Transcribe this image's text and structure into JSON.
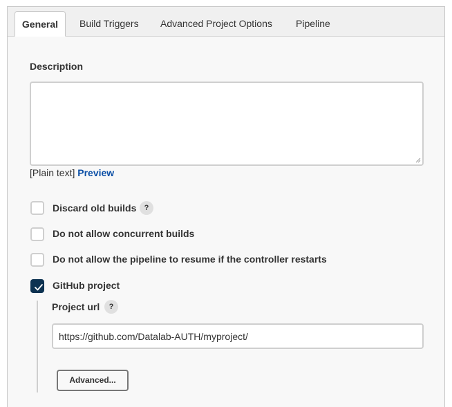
{
  "tabs": [
    {
      "label": "General",
      "active": true
    },
    {
      "label": "Build Triggers",
      "active": false
    },
    {
      "label": "Advanced Project Options",
      "active": false
    },
    {
      "label": "Pipeline",
      "active": false
    }
  ],
  "description": {
    "label": "Description",
    "value": "",
    "format_prefix": "[Plain text]",
    "preview_link": "Preview"
  },
  "options": [
    {
      "label": "Discard old builds",
      "checked": false,
      "has_help": true
    },
    {
      "label": "Do not allow concurrent builds",
      "checked": false,
      "has_help": false
    },
    {
      "label": "Do not allow the pipeline to resume if the controller restarts",
      "checked": false,
      "has_help": false
    },
    {
      "label": "GitHub project",
      "checked": true,
      "has_help": false
    }
  ],
  "github": {
    "project_url_label": "Project url",
    "project_url_value": "https://github.com/Datalab-AUTH/myproject/",
    "advanced_button": "Advanced..."
  },
  "help_glyph": "?",
  "colors": {
    "accent": "#0d3251",
    "link": "#0b4fa6"
  }
}
